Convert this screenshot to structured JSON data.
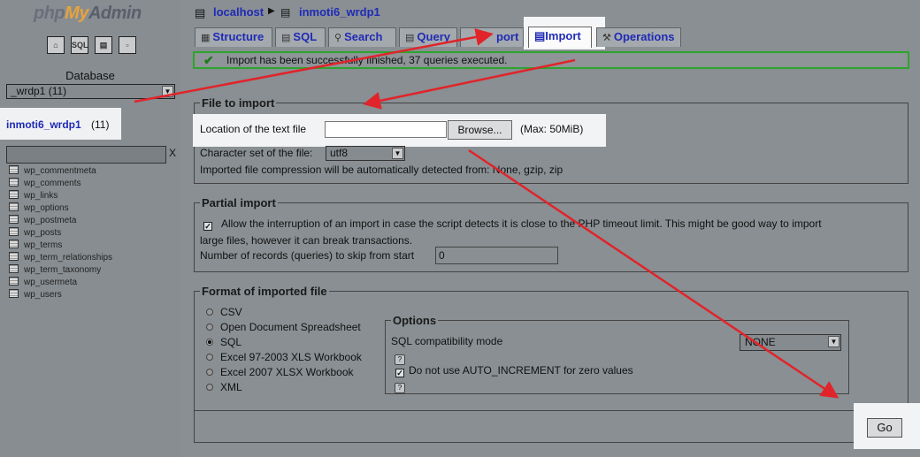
{
  "app": {
    "logo_php": "php",
    "logo_my": "My",
    "logo_admin": "Admin"
  },
  "sidebar": {
    "icons": [
      "home-icon",
      "sql-icon",
      "query-window-icon",
      "docs-icon"
    ],
    "sql_icon_text": "SQL",
    "database_label": "Database",
    "database_select_value": "_wrdp1 (11)",
    "current_db_name": "inmoti6_wrdp1",
    "current_db_count": "(11)",
    "filter_clear": "X",
    "tables": [
      "wp_commentmeta",
      "wp_comments",
      "wp_links",
      "wp_options",
      "wp_postmeta",
      "wp_posts",
      "wp_terms",
      "wp_term_relationships",
      "wp_term_taxonomy",
      "wp_usermeta",
      "wp_users"
    ]
  },
  "breadcrumb": {
    "server": "localhost",
    "database": "inmoti6_wrdp1"
  },
  "tabs": [
    {
      "label": "Structure",
      "icon": "structure-icon"
    },
    {
      "label": "SQL",
      "icon": "sql-icon"
    },
    {
      "label": "Search",
      "icon": "search-icon"
    },
    {
      "label": "Query",
      "icon": "query-icon"
    },
    {
      "label": "port",
      "icon": "export-icon"
    },
    {
      "label": "Import",
      "icon": "import-icon",
      "active": true
    },
    {
      "label": "Operations",
      "icon": "operations-icon"
    }
  ],
  "message": {
    "success": "Import has been successfully finished, 37 queries executed."
  },
  "file_import": {
    "legend": "File to import",
    "location_label": "Location of the text file",
    "browse_label": "Browse...",
    "max_size": "(Max: 50MiB)",
    "charset_label": "Character set of the file:",
    "charset_value": "utf8",
    "compression_note": "Imported file compression will be automatically detected from: None, gzip, zip"
  },
  "partial_import": {
    "legend": "Partial import",
    "allow_interrupt_line1": "Allow the interruption of an import in case the script detects it is close to the PHP timeout limit. This might be good way to import",
    "allow_interrupt_line2": "large files, however it can break transactions.",
    "allow_interrupt_checked": true,
    "skip_label": "Number of records (queries) to skip from start",
    "skip_value": "0"
  },
  "format": {
    "legend": "Format of imported file",
    "options": [
      "CSV",
      "Open Document Spreadsheet",
      "SQL",
      "Excel 97-2003 XLS Workbook",
      "Excel 2007 XLSX Workbook",
      "XML"
    ],
    "selected": "SQL",
    "options_legend": "Options",
    "sql_compat_label": "SQL compatibility mode",
    "sql_compat_value": "NONE",
    "no_auto_increment_label": "Do not use AUTO_INCREMENT for zero values",
    "no_auto_increment_checked": true,
    "help_glyph": "?"
  },
  "actions": {
    "go_label": "Go"
  },
  "colors": {
    "annotation_arrow": "#e0242a",
    "highlight_box": "#f2f3f4",
    "success_border": "#2ca52c",
    "link_blue": "#1f2bb5"
  }
}
